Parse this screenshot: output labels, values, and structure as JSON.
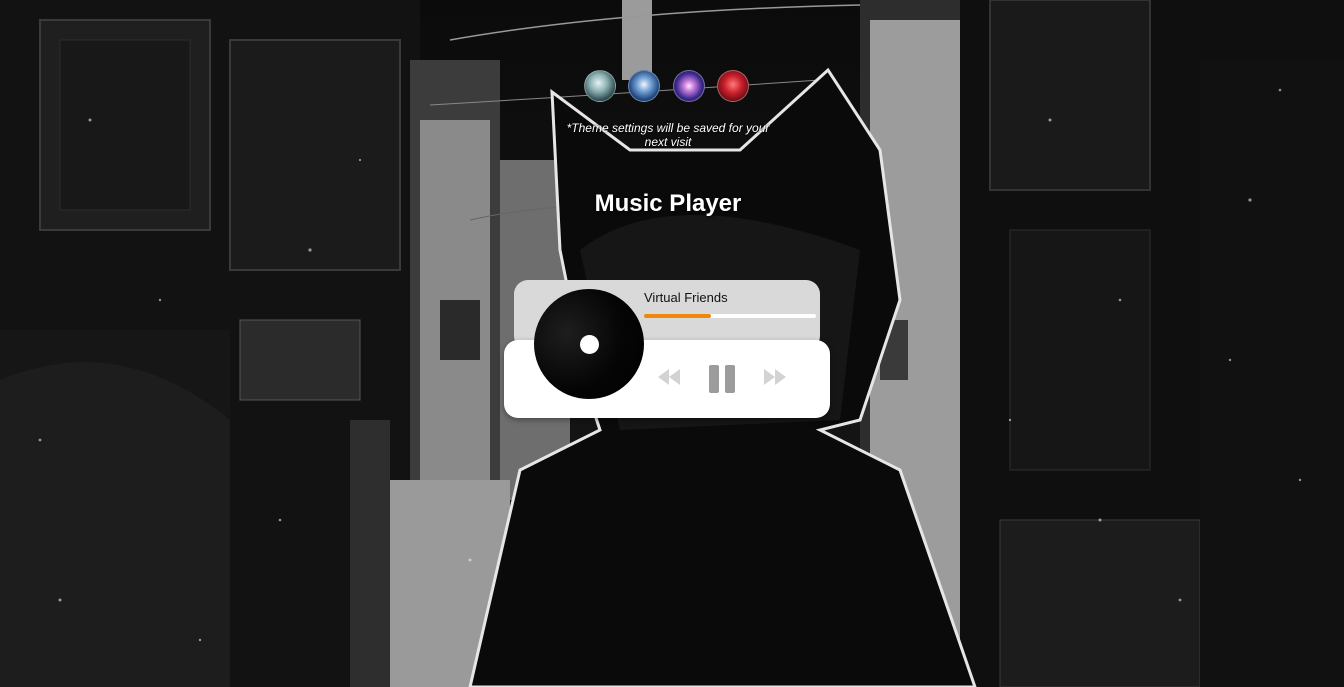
{
  "themes": [
    {
      "name": "theme-alley-teal",
      "color": "#8fb2b4"
    },
    {
      "name": "theme-blue-glow",
      "color": "#7aa6d8"
    },
    {
      "name": "theme-purple-neon",
      "color": "#c47bd8"
    },
    {
      "name": "theme-crimson",
      "color": "#c81f2b"
    }
  ],
  "theme_note": "*Theme settings will be saved for your next visit",
  "player": {
    "title": "Music Player",
    "track_name": "Virtual Friends",
    "progress": 0.39,
    "accent_color": "#f0860a",
    "controls": {
      "prev_icon": "rewind-icon",
      "play_icon": "pause-icon",
      "next_icon": "fast-forward-icon"
    }
  }
}
